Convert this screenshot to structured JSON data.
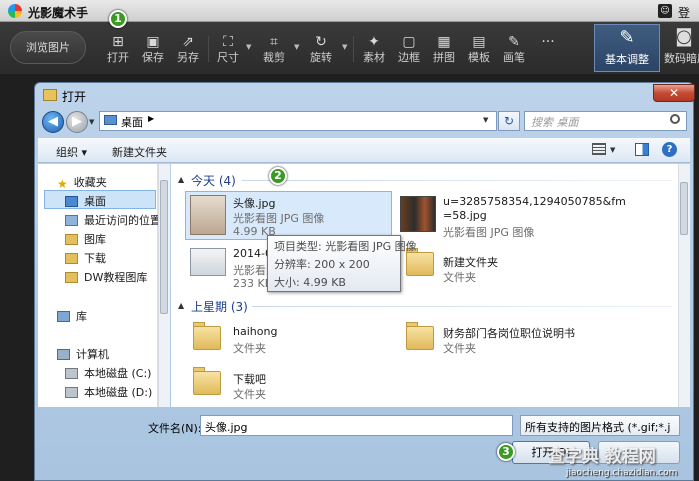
{
  "app": {
    "title": "光影魔术手",
    "login": "登录",
    "browse_button": "浏览图片",
    "tools": [
      {
        "icon": "import-icon",
        "label": "打开"
      },
      {
        "icon": "save-icon",
        "label": "保存"
      },
      {
        "icon": "save-as-icon",
        "label": "另存"
      },
      {
        "icon": "resize-icon",
        "label": "尺寸"
      },
      {
        "icon": "crop-icon",
        "label": "裁剪"
      },
      {
        "icon": "rotate-icon",
        "label": "旋转"
      },
      {
        "icon": "material-icon",
        "label": "素材"
      },
      {
        "icon": "border-icon",
        "label": "边框"
      },
      {
        "icon": "collage-icon",
        "label": "拼图"
      },
      {
        "icon": "template-icon",
        "label": "模板"
      },
      {
        "icon": "brush-icon",
        "label": "画笔"
      }
    ],
    "more": "···",
    "tab_basic": "基本调整",
    "tab_digital": "数码暗房"
  },
  "steps": [
    "1",
    "2",
    "3"
  ],
  "dialog": {
    "title": "打开",
    "close": "✕",
    "address": "桌面",
    "search_placeholder": "搜索 桌面",
    "organize": "组织 ▾",
    "new_folder": "新建文件夹",
    "nav": {
      "favorites": "收藏夹",
      "desktop": "桌面",
      "recent": "最近访问的位置",
      "library_pics": "图库",
      "downloads": "下载",
      "dw_lib": "DW教程图库",
      "libraries": "库",
      "computer": "计算机",
      "drive_c": "本地磁盘 (C:)",
      "drive_d": "本地磁盘 (D:)"
    },
    "groups": {
      "today": "今天 (4)",
      "last_week": "上星期 (3)"
    },
    "files": {
      "f1_name": "头像.jpg",
      "f1_type": "光影看图 JPG 图像",
      "f1_size": "4.99 KB",
      "f2_name": "u=3285758354,1294050785&fm",
      "f2_name2": "=58.jpg",
      "f2_type": "光影看图 JPG 图像",
      "f3_name": "2014-08-25_095144.png",
      "f3_type": "光影看图 PNG 图像",
      "f3_size": "233 KB",
      "f4_name": "新建文件夹",
      "f4_type": "文件夹",
      "f5_name": "haihong",
      "f5_type": "文件夹",
      "f6_name": "财务部门各岗位职位说明书",
      "f6_type": "文件夹",
      "f7_name": "下载吧",
      "f7_type": "文件夹"
    },
    "tooltip": {
      "line1": "项目类型: 光影看图 JPG 图像",
      "line2": "分辨率: 200 x 200",
      "line3": "大小: 4.99 KB"
    },
    "filename_label": "文件名(N):",
    "filename_value": "头像.jpg",
    "filetype": "所有支持的图片格式 (*.gif;*.j",
    "open_button": "打开(O)",
    "cancel_button": ""
  },
  "watermark": {
    "line1": "查字典 教程网",
    "line2": "jiaocheng.chazidian.com"
  }
}
